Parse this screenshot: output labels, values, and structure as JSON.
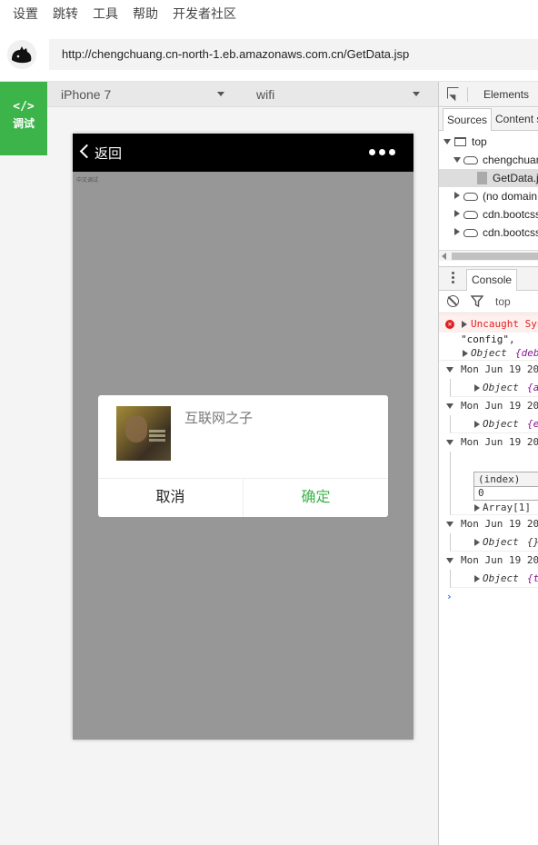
{
  "menu": {
    "items": [
      "设置",
      "跳转",
      "工具",
      "帮助",
      "开发者社区"
    ]
  },
  "address": {
    "url": "http://chengchuang.cn-north-1.eb.amazonaws.com.cn/GetData.jsp"
  },
  "sidebar": {
    "debug_glyph": "</>",
    "debug_label": "调试",
    "accent": "#3cb449"
  },
  "simulator": {
    "device": "iPhone 7",
    "network": "wifi",
    "page": {
      "nav_back_label": "返回",
      "page_tag": "中文调试",
      "dialog": {
        "title": "互联网之子",
        "cancel_label": "取消",
        "confirm_label": "确定"
      }
    }
  },
  "devtools": {
    "tab_elements": "Elements",
    "sources_tabs": [
      "Sources",
      "Content s"
    ],
    "tree": [
      {
        "label": "top",
        "icon": "frame-icon",
        "expanded": true
      },
      {
        "label": "chengchuan",
        "icon": "cloud-icon",
        "expanded": true
      },
      {
        "label": "GetData.js",
        "icon": "file-icon",
        "selected": true
      },
      {
        "label": "(no domain",
        "icon": "cloud-icon",
        "expanded": false
      },
      {
        "label": "cdn.bootcss",
        "icon": "cloud-icon",
        "expanded": false
      },
      {
        "label": "cdn.bootcss",
        "icon": "cloud-icon",
        "expanded": false
      }
    ],
    "console_tab": "Console",
    "context": "top",
    "logs": {
      "error": "Uncaught Syn",
      "config_text": "\"config\",",
      "object_debu_prefix": "Object ",
      "object_debu_key": "{debu",
      "timestamp": "Mon Jun 19 20",
      "objects": [
        "{ap",
        "{er"
      ],
      "index_header": "(index)",
      "index_value": "0",
      "array_label": "Array[1]",
      "object_empty": "{}",
      "object_t": "{t"
    },
    "error_color": "#e02020",
    "prompt_glyph": "›"
  }
}
